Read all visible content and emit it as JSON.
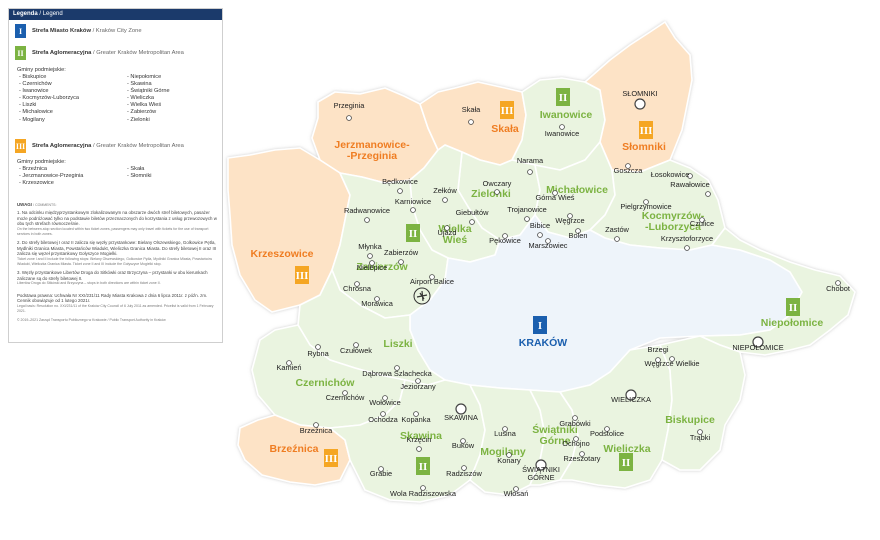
{
  "legend": {
    "title": "Legenda",
    "title_sep": "/",
    "title_en": "Legend",
    "zone1": {
      "badge": "I",
      "label": "Strefa Miasto Kraków",
      "label_en": "/ Kraków City Zone",
      "color": "#1b5fae"
    },
    "zone2": {
      "badge": "II",
      "label": "Strefa Aglomeracyjna",
      "label_en": "/ Greater Kraków Metropolitan Area",
      "color": "#7cb342"
    },
    "zone2_communes_title": "Gminy podmiejskie:",
    "zone2_communes_col1": [
      "- Biskupice",
      "- Czernichów",
      "- Iwanowice",
      "- Kocmyrzów-Luborzyca",
      "- Liszki",
      "- Michałowice",
      "- Mogilany"
    ],
    "zone2_communes_col2": [
      "- Niepołomice",
      "- Skawina",
      "- Świątniki Górne",
      "- Wieliczka",
      "- Wielka Wieś",
      "- Zabierzów",
      "- Zielonki"
    ],
    "zone3": {
      "badge": "III",
      "label": "Strefa Aglomeracyjna",
      "label_en": "/ Greater Kraków Metropolitan Area",
      "color": "#f5a623"
    },
    "zone3_communes_title": "Gminy podmiejskie:",
    "zone3_communes_col1": [
      "- Brzeźnica",
      "- Jerzmanowice-Przeginia",
      "- Krzeszowice"
    ],
    "zone3_communes_col2": [
      "- Skała",
      "- Słomniki"
    ],
    "notes_title": "UWAGI",
    "notes_title_en": "/ COMMENTS:",
    "note1": "1. Na odcinku międzyprzystankowym zlokalizowanym na obszarze dwóch stref biletowych, pasażer może podróżować tylko na podstawie biletów przeznaczonych do korzystania z usług przewozowych w obu tych strefach równocześnie.",
    "note1_en": "On the between-stop section located within two ticket zones, passengers may only travel with tickets for the use of transport services in both zones.",
    "note2": "2. Do strefy biletowej I oraz II zalicza się węzły przystankowe: Bielany Olszewskiego, Golkowice Pętla, Mydlniki Granica Miasta, Powstańców Wiadukt, Wieliczka Granica Miasta. Do strefy biletowej II oraz III zalicza się węzeł przystankowy Gołyszyce Mogielki.",
    "note2_en": "Ticket zone I and II include the following stops: Bielany Olszewskiego, Golkowice Pętla, Mydlniki Granica Miasta, Powstańców Wiadukt, Wieliczka Granica Miasta. Ticket zone II and III include the Gołyszyce Mogielki stop.",
    "note3": "3. Węzły przystankowe Libertów Droga do Sitkówki oraz Brzyczyna – przystanki w obu kierunkach zaliczane są do strefy biletowej II.",
    "note3_en": "Libertów Droga do Sitkówki and Brzyczyna – stops in both directions are within ticket zone II.",
    "legal": "Podstawa prawna: Uchwała Nr XXI/231/11 Rady Miasta Krakowa z dnia 6 lipca 2011r. z późn. zm. Cennik obowiązuje od 1 lutego 2021r.",
    "legal_en": "Legal basis: Resolution no. XXI/231/11 of the Kraków City Council of 6 July 2011 as amended. Pricelist is valid from 1 February 2021.",
    "copyright": "© 2019–2021 Zarząd Transportu Publicznego w Krakowie / Public Transport Authority in Kraków"
  },
  "map": {
    "communes": [
      {
        "name": "Jerzmanowice-\n-Przeginia",
        "zone": "III"
      },
      {
        "name": "Skała",
        "zone": "III"
      },
      {
        "name": "Iwanowice",
        "zone": "II"
      },
      {
        "name": "Słomniki",
        "zone": "III"
      },
      {
        "name": "Zielonki",
        "zone": "II"
      },
      {
        "name": "Michałowice",
        "zone": "II"
      },
      {
        "name": "Kocmyrzów-\n-Luborzyca",
        "zone": "II"
      },
      {
        "name": "Wielka\nWieś",
        "zone": "II"
      },
      {
        "name": "Krzeszowice",
        "zone": "III"
      },
      {
        "name": "Zabierzów",
        "zone": "II"
      },
      {
        "name": "Liszki",
        "zone": "II"
      },
      {
        "name": "KRAKÓW",
        "zone": "I"
      },
      {
        "name": "Niepołomice",
        "zone": "II"
      },
      {
        "name": "Czernichów",
        "zone": "II"
      },
      {
        "name": "Brzeźnica",
        "zone": "III"
      },
      {
        "name": "Skawina",
        "zone": "II"
      },
      {
        "name": "Mogilany",
        "zone": "II"
      },
      {
        "name": "Świątniki\nGórne",
        "zone": "II"
      },
      {
        "name": "Wieliczka",
        "zone": "II"
      },
      {
        "name": "Biskupice",
        "zone": "II"
      }
    ],
    "towns": [
      "Przeginia",
      "Skała",
      "SŁOMNIKI",
      "Iwanowice",
      "Narama",
      "Goszcza",
      "Łosokowice",
      "Rawałowice",
      "Będkowice",
      "Zełków",
      "Owczary",
      "Górna Wieś",
      "Karniowice",
      "Pielgrzymowice",
      "Radwanowice",
      "Giebułtów",
      "Trojanowice",
      "Węgrzce",
      "Czulice",
      "Bibice",
      "Bolen",
      "Zastów",
      "Ujazd",
      "Pękowice",
      "Marszowiec",
      "Krzysztoforzyce",
      "Młynka",
      "Zabierzów",
      "Nielepice",
      "Airport Balice",
      "Chrosna",
      "Morawica",
      "Chobot",
      "Rybna",
      "Czułówek",
      "NIEPOŁOMICE",
      "Brzegi",
      "Kamień",
      "Dąbrowa Szlachecka",
      "Węgrzce Wielkie",
      "Jeziorzany",
      "WIELICZKA",
      "Czernichów",
      "Wołowice",
      "Ochodza",
      "Kopanka",
      "SKAWINA",
      "Grabówki",
      "Lusina",
      "Podstolice",
      "Trąbki",
      "Brzeźnica",
      "Krzęcin",
      "Buków",
      "Ochojno",
      "Rzeszotary",
      "Konary",
      "ŚWIĄTNIKI\nGÓRNE",
      "Grabie",
      "Radziszów",
      "Wola Radziszowska",
      "Włosań"
    ],
    "colors": {
      "zone1_fill": "#eef4fa",
      "zone2_fill": "#eaf4e0",
      "zone3_fill": "#fde3c6",
      "border": "#ffffff"
    }
  }
}
